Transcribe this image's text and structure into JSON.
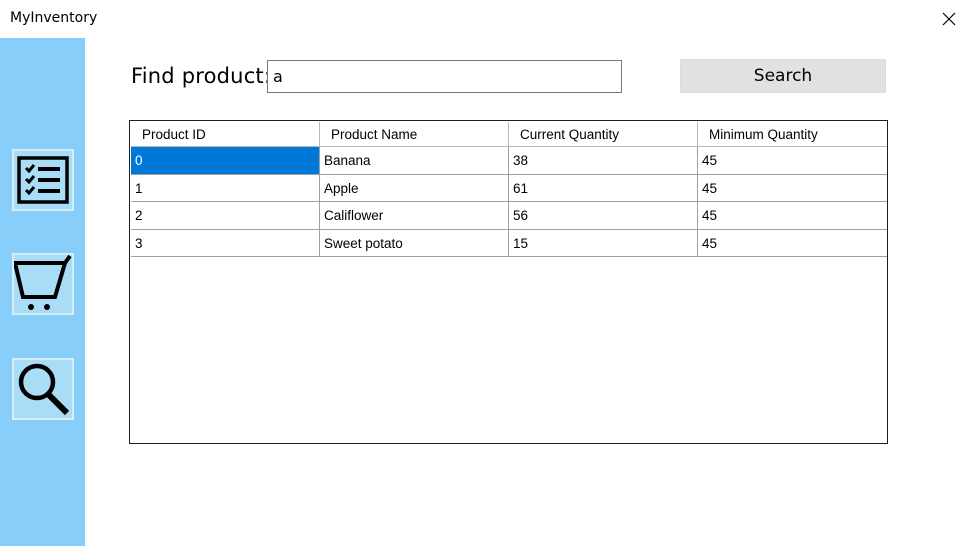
{
  "window": {
    "title": "MyInventory"
  },
  "sidebar": {
    "items": [
      {
        "icon": "checklist-icon"
      },
      {
        "icon": "cart-icon"
      },
      {
        "icon": "magnifier-icon"
      }
    ]
  },
  "search": {
    "label": "Find product:",
    "value": "a",
    "button_label": "Search"
  },
  "table": {
    "columns": [
      "Product ID",
      "Product Name",
      "Current Quantity",
      "Minimum Quantity"
    ],
    "rows": [
      [
        "0",
        "Banana",
        "38",
        "45"
      ],
      [
        "1",
        "Apple",
        "61",
        "45"
      ],
      [
        "2",
        "Califlower",
        "56",
        "45"
      ],
      [
        "3",
        "Sweet potato",
        "15",
        "45"
      ]
    ],
    "selected_cell": {
      "row": 0,
      "column": 0
    }
  },
  "colors": {
    "sidebar": "#87cefa",
    "nav_button": "#a9dcf7",
    "selection": "#0078d7",
    "search_button": "#e1e1e1"
  }
}
